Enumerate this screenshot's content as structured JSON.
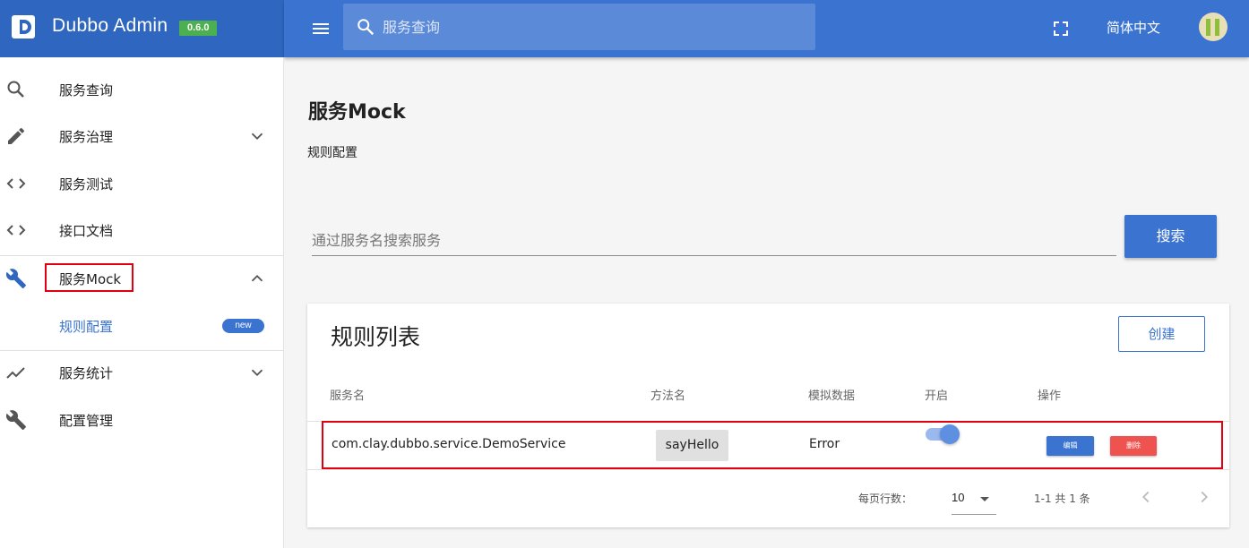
{
  "app": {
    "name": "Dubbo Admin",
    "version": "0.6.0"
  },
  "topbar": {
    "search_placeholder": "服务查询",
    "language": "简体中文",
    "icons": [
      "menu-icon",
      "search-icon",
      "fullscreen-icon",
      "avatar"
    ]
  },
  "sidebar": {
    "items": [
      {
        "label": "服务查询",
        "icon": "search-icon"
      },
      {
        "label": "服务治理",
        "icon": "pencil-icon",
        "expandable": true
      },
      {
        "label": "服务测试",
        "icon": "code-icon"
      },
      {
        "label": "接口文档",
        "icon": "code-icon"
      },
      {
        "label": "服务Mock",
        "icon": "wrench-icon",
        "expanded": true
      },
      {
        "label": "服务统计",
        "icon": "trending-icon",
        "expandable": true
      },
      {
        "label": "配置管理",
        "icon": "wrench-icon"
      }
    ],
    "sub_item": {
      "label": "规则配置",
      "badge": "new"
    }
  },
  "main": {
    "title": "服务Mock",
    "subtitle": "规则配置",
    "search_placeholder": "通过服务名搜索服务",
    "search_button": "搜索",
    "card": {
      "title": "规则列表",
      "create_button": "创建",
      "columns": [
        "服务名",
        "方法名",
        "模拟数据",
        "开启",
        "操作"
      ],
      "rows": [
        {
          "service": "com.clay.dubbo.service.DemoService",
          "method": "sayHello",
          "mock_data": "Error",
          "enabled": true,
          "edit": "编辑",
          "delete": "删除"
        }
      ],
      "footer": {
        "rows_per_page_label": "每页行数：",
        "rows_per_page": "10",
        "range": "1-1 共 1 条"
      }
    }
  },
  "colors": {
    "primary": "#3a73d0",
    "brand_bg": "#2f67c0",
    "danger": "#ef5350",
    "highlight": "#e1000f",
    "version_badge": "#4caf50"
  }
}
